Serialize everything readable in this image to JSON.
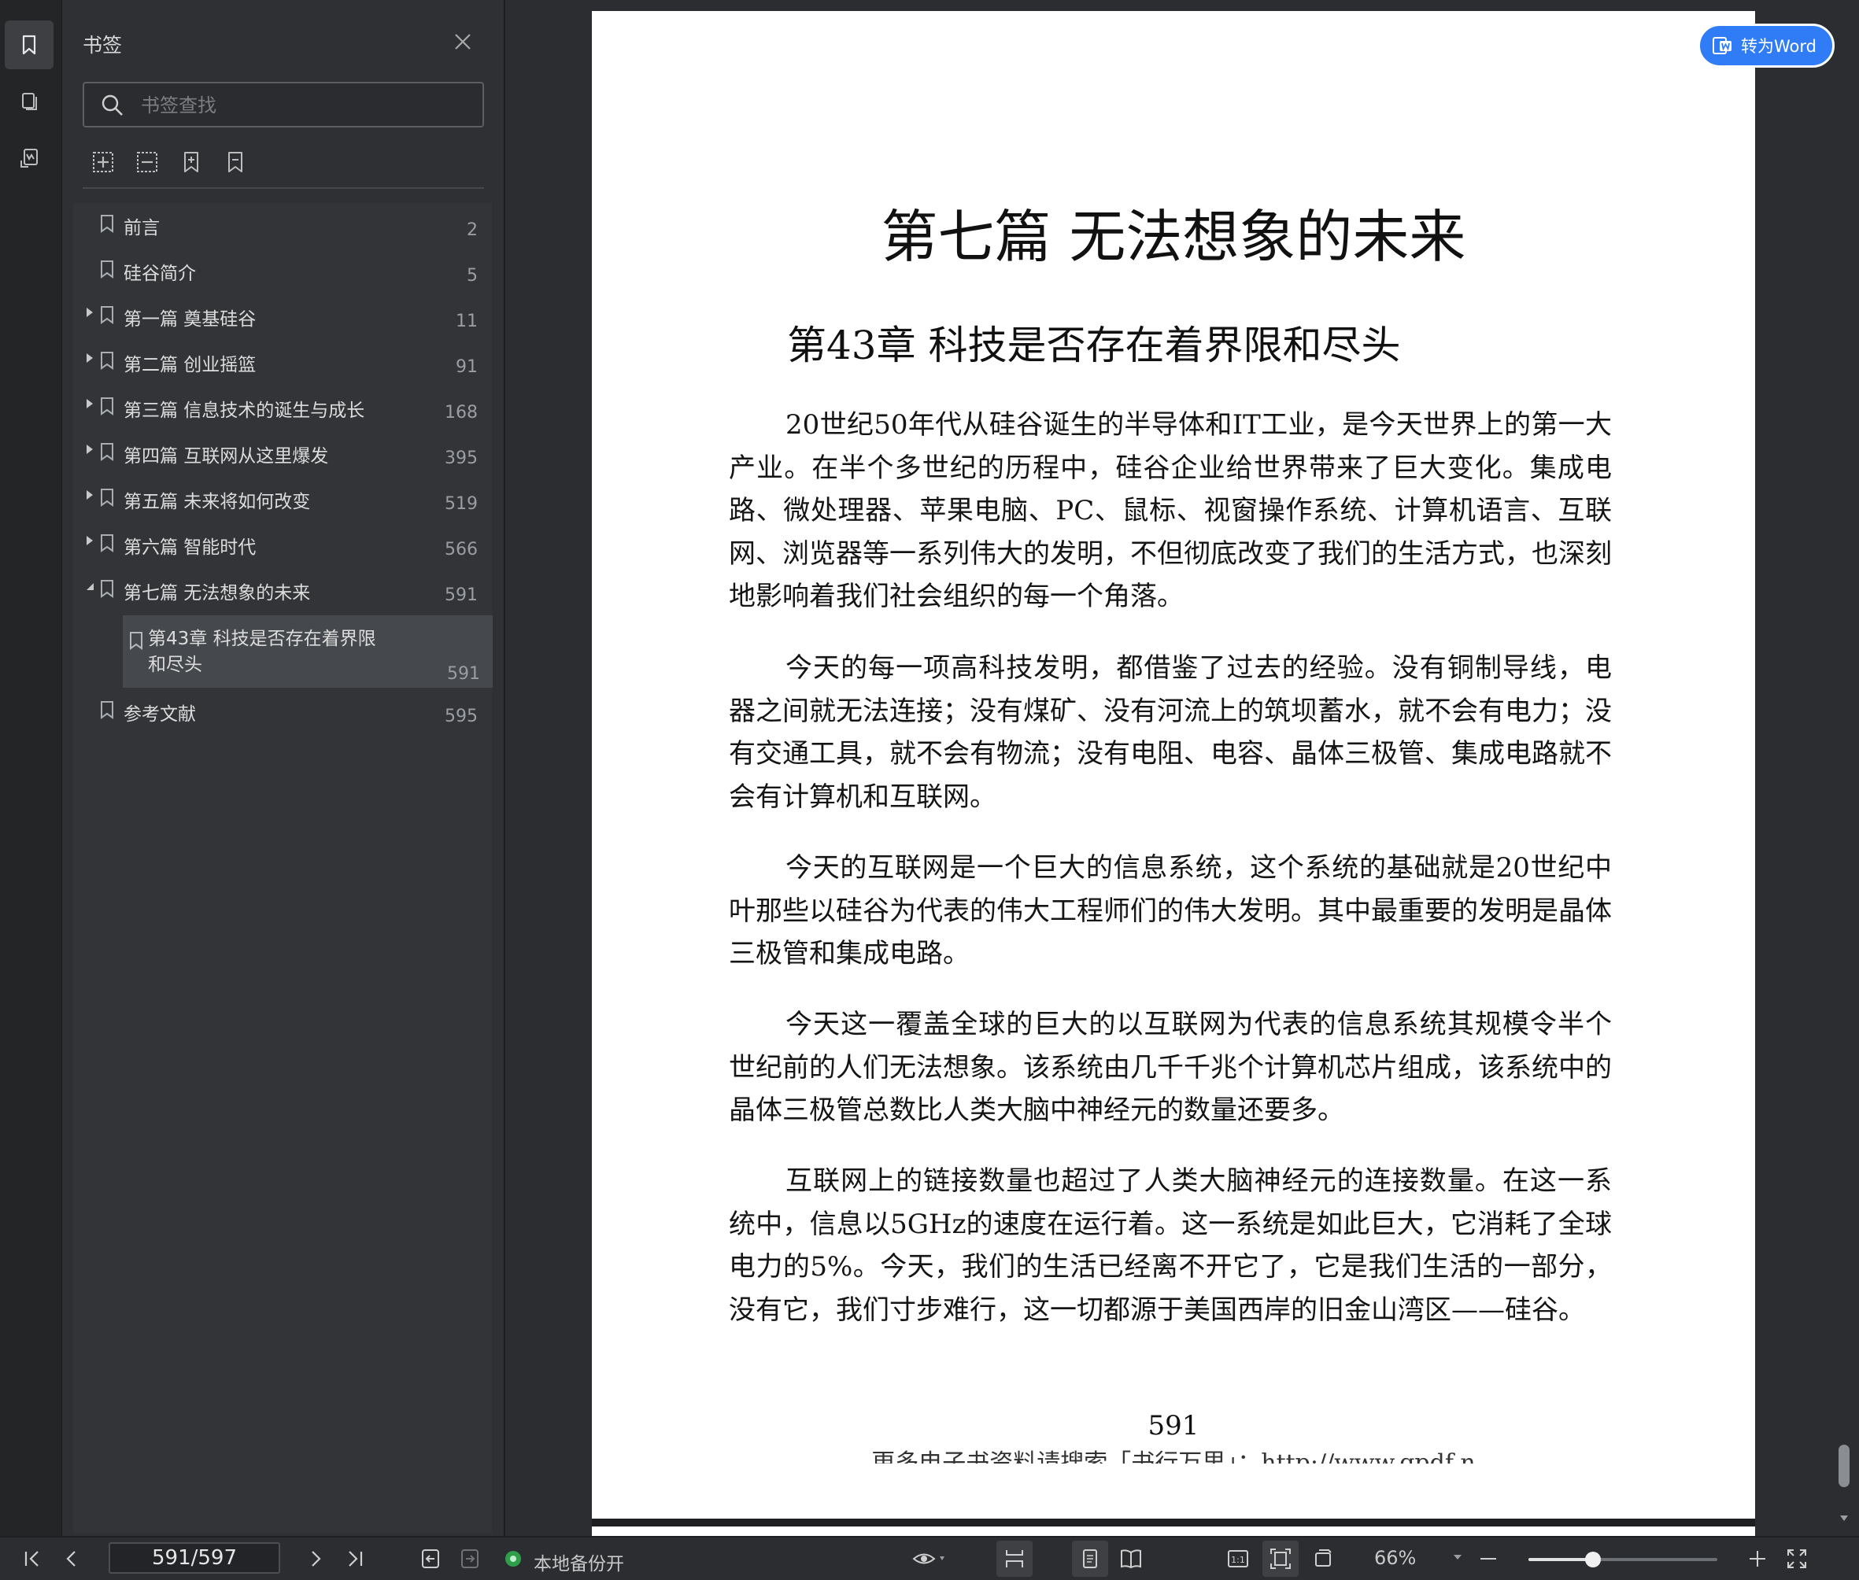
{
  "sidebar_rail": {
    "items": [
      {
        "icon": "bookmark-icon",
        "active": true
      },
      {
        "icon": "pages-icon",
        "active": false
      },
      {
        "icon": "annotation-icon",
        "active": false
      }
    ]
  },
  "bookmarks_panel": {
    "title": "书签",
    "search_placeholder": "书签查找",
    "tools": [
      "expand-all-icon",
      "collapse-all-icon",
      "add-bookmark-icon",
      "remove-bookmark-icon"
    ],
    "items": [
      {
        "label": "前言",
        "page": "2",
        "expandable": false,
        "expanded": false
      },
      {
        "label": "硅谷简介",
        "page": "5",
        "expandable": false,
        "expanded": false
      },
      {
        "label": "第一篇 奠基硅谷",
        "page": "11",
        "expandable": true,
        "expanded": false
      },
      {
        "label": "第二篇 创业摇篮",
        "page": "91",
        "expandable": true,
        "expanded": false
      },
      {
        "label": "第三篇 信息技术的诞生与成长",
        "page": "168",
        "expandable": true,
        "expanded": false
      },
      {
        "label": "第四篇 互联网从这里爆发",
        "page": "395",
        "expandable": true,
        "expanded": false
      },
      {
        "label": "第五篇 未来将如何改变",
        "page": "519",
        "expandable": true,
        "expanded": false
      },
      {
        "label": "第六篇 智能时代",
        "page": "566",
        "expandable": true,
        "expanded": false
      },
      {
        "label": "第七篇 无法想象的未来",
        "page": "591",
        "expandable": true,
        "expanded": true
      },
      {
        "label": "第43章 科技是否存在着界限和尽头",
        "page": "591",
        "child": true,
        "selected": true
      },
      {
        "label": "参考文献",
        "page": "595",
        "expandable": false,
        "expanded": false
      }
    ]
  },
  "document": {
    "convert_button": "转为Word",
    "part_title": "第七篇 无法想象的未来",
    "chapter_title": "第43章 科技是否存在着界限和尽头",
    "paragraphs": [
      "20世纪50年代从硅谷诞生的半导体和IT工业，是今天世界上的第一大产业。在半个多世纪的历程中，硅谷企业给世界带来了巨大变化。集成电路、微处理器、苹果电脑、PC、鼠标、视窗操作系统、计算机语言、互联网、浏览器等一系列伟大的发明，不但彻底改变了我们的生活方式，也深刻地影响着我们社会组织的每一个角落。",
      "今天的每一项高科技发明，都借鉴了过去的经验。没有铜制导线，电器之间就无法连接；没有煤矿、没有河流上的筑坝蓄水，就不会有电力；没有交通工具，就不会有物流；没有电阻、电容、晶体三极管、集成电路就不会有计算机和互联网。",
      "今天的互联网是一个巨大的信息系统，这个系统的基础就是20世纪中叶那些以硅谷为代表的伟大工程师们的伟大发明。其中最重要的发明是晶体三极管和集成电路。",
      "今天这一覆盖全球的巨大的以互联网为代表的信息系统其规模令半个世纪前的人们无法想象。该系统由几千千兆个计算机芯片组成，该系统中的晶体三极管总数比人类大脑中神经元的数量还要多。",
      "互联网上的链接数量也超过了人类大脑神经元的连接数量。在这一系统中，信息以5GHz的速度在运行着。这一系统是如此巨大，它消耗了全球电力的5%。今天，我们的生活已经离不开它了，它是我们生活的一部分，没有它，我们寸步难行，这一切都源于美国西岸的旧金山湾区——硅谷。"
    ],
    "page_number": "591",
    "footer_text": "更多电子书资料请搜索「书行万里」：http://www.gpdf.n"
  },
  "statusbar": {
    "page_indicator": "591/597",
    "backup_status": "本地备份开",
    "zoom": "66%",
    "zoom_fraction": 0.34
  }
}
